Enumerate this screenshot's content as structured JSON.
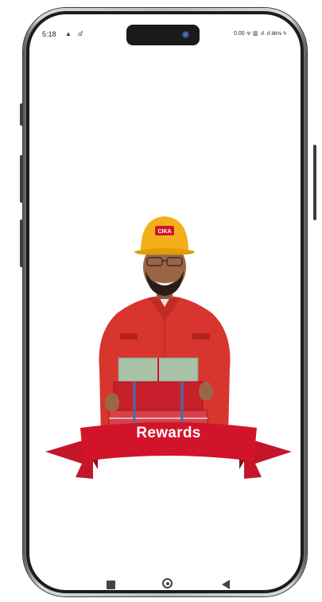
{
  "status_bar": {
    "time": "5:18",
    "left_icons": "▲ ⅆ",
    "right_text": "0.00 ᯤ ▥ .ıl .ıl",
    "battery": "88%"
  },
  "screen": {
    "title": "Rewards"
  },
  "hero": {
    "helmet_logo": "CIKA"
  },
  "colors": {
    "brand_red": "#d2142b",
    "shirt_red": "#d8352e",
    "helmet_yellow": "#f3b01b",
    "ribbon_dark": "#a80f22"
  },
  "nav_bar": {
    "icons": [
      "recent-apps-icon",
      "home-icon",
      "back-icon"
    ]
  }
}
